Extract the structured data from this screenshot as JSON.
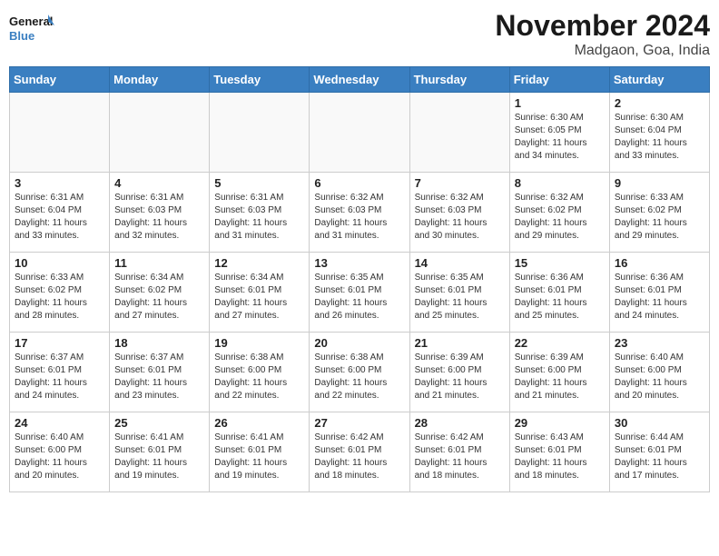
{
  "header": {
    "logo_text_general": "General",
    "logo_text_blue": "Blue",
    "month_title": "November 2024",
    "location": "Madgaon, Goa, India"
  },
  "weekdays": [
    "Sunday",
    "Monday",
    "Tuesday",
    "Wednesday",
    "Thursday",
    "Friday",
    "Saturday"
  ],
  "weeks": [
    [
      {
        "day": "",
        "info": ""
      },
      {
        "day": "",
        "info": ""
      },
      {
        "day": "",
        "info": ""
      },
      {
        "day": "",
        "info": ""
      },
      {
        "day": "",
        "info": ""
      },
      {
        "day": "1",
        "info": "Sunrise: 6:30 AM\nSunset: 6:05 PM\nDaylight: 11 hours and 34 minutes."
      },
      {
        "day": "2",
        "info": "Sunrise: 6:30 AM\nSunset: 6:04 PM\nDaylight: 11 hours and 33 minutes."
      }
    ],
    [
      {
        "day": "3",
        "info": "Sunrise: 6:31 AM\nSunset: 6:04 PM\nDaylight: 11 hours and 33 minutes."
      },
      {
        "day": "4",
        "info": "Sunrise: 6:31 AM\nSunset: 6:03 PM\nDaylight: 11 hours and 32 minutes."
      },
      {
        "day": "5",
        "info": "Sunrise: 6:31 AM\nSunset: 6:03 PM\nDaylight: 11 hours and 31 minutes."
      },
      {
        "day": "6",
        "info": "Sunrise: 6:32 AM\nSunset: 6:03 PM\nDaylight: 11 hours and 31 minutes."
      },
      {
        "day": "7",
        "info": "Sunrise: 6:32 AM\nSunset: 6:03 PM\nDaylight: 11 hours and 30 minutes."
      },
      {
        "day": "8",
        "info": "Sunrise: 6:32 AM\nSunset: 6:02 PM\nDaylight: 11 hours and 29 minutes."
      },
      {
        "day": "9",
        "info": "Sunrise: 6:33 AM\nSunset: 6:02 PM\nDaylight: 11 hours and 29 minutes."
      }
    ],
    [
      {
        "day": "10",
        "info": "Sunrise: 6:33 AM\nSunset: 6:02 PM\nDaylight: 11 hours and 28 minutes."
      },
      {
        "day": "11",
        "info": "Sunrise: 6:34 AM\nSunset: 6:02 PM\nDaylight: 11 hours and 27 minutes."
      },
      {
        "day": "12",
        "info": "Sunrise: 6:34 AM\nSunset: 6:01 PM\nDaylight: 11 hours and 27 minutes."
      },
      {
        "day": "13",
        "info": "Sunrise: 6:35 AM\nSunset: 6:01 PM\nDaylight: 11 hours and 26 minutes."
      },
      {
        "day": "14",
        "info": "Sunrise: 6:35 AM\nSunset: 6:01 PM\nDaylight: 11 hours and 25 minutes."
      },
      {
        "day": "15",
        "info": "Sunrise: 6:36 AM\nSunset: 6:01 PM\nDaylight: 11 hours and 25 minutes."
      },
      {
        "day": "16",
        "info": "Sunrise: 6:36 AM\nSunset: 6:01 PM\nDaylight: 11 hours and 24 minutes."
      }
    ],
    [
      {
        "day": "17",
        "info": "Sunrise: 6:37 AM\nSunset: 6:01 PM\nDaylight: 11 hours and 24 minutes."
      },
      {
        "day": "18",
        "info": "Sunrise: 6:37 AM\nSunset: 6:01 PM\nDaylight: 11 hours and 23 minutes."
      },
      {
        "day": "19",
        "info": "Sunrise: 6:38 AM\nSunset: 6:00 PM\nDaylight: 11 hours and 22 minutes."
      },
      {
        "day": "20",
        "info": "Sunrise: 6:38 AM\nSunset: 6:00 PM\nDaylight: 11 hours and 22 minutes."
      },
      {
        "day": "21",
        "info": "Sunrise: 6:39 AM\nSunset: 6:00 PM\nDaylight: 11 hours and 21 minutes."
      },
      {
        "day": "22",
        "info": "Sunrise: 6:39 AM\nSunset: 6:00 PM\nDaylight: 11 hours and 21 minutes."
      },
      {
        "day": "23",
        "info": "Sunrise: 6:40 AM\nSunset: 6:00 PM\nDaylight: 11 hours and 20 minutes."
      }
    ],
    [
      {
        "day": "24",
        "info": "Sunrise: 6:40 AM\nSunset: 6:00 PM\nDaylight: 11 hours and 20 minutes."
      },
      {
        "day": "25",
        "info": "Sunrise: 6:41 AM\nSunset: 6:01 PM\nDaylight: 11 hours and 19 minutes."
      },
      {
        "day": "26",
        "info": "Sunrise: 6:41 AM\nSunset: 6:01 PM\nDaylight: 11 hours and 19 minutes."
      },
      {
        "day": "27",
        "info": "Sunrise: 6:42 AM\nSunset: 6:01 PM\nDaylight: 11 hours and 18 minutes."
      },
      {
        "day": "28",
        "info": "Sunrise: 6:42 AM\nSunset: 6:01 PM\nDaylight: 11 hours and 18 minutes."
      },
      {
        "day": "29",
        "info": "Sunrise: 6:43 AM\nSunset: 6:01 PM\nDaylight: 11 hours and 18 minutes."
      },
      {
        "day": "30",
        "info": "Sunrise: 6:44 AM\nSunset: 6:01 PM\nDaylight: 11 hours and 17 minutes."
      }
    ]
  ]
}
